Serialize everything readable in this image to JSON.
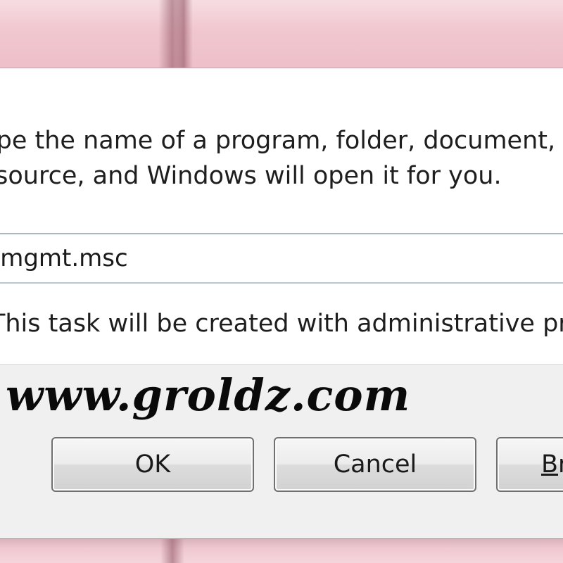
{
  "dialog": {
    "message_line_1": "Type the name of a program, folder, document, or Internet",
    "message_line_2": "resource, and Windows will open it for you.",
    "open_input_value": "compmgmt.msc",
    "admin_note": "This task will be created with administrative privileges."
  },
  "buttons": {
    "ok_label": "OK",
    "cancel_label": "Cancel",
    "browse_label": "Browse..."
  },
  "watermark": "www.groldz.com",
  "colors": {
    "frame": "#f1c7cf",
    "client": "#ffffff",
    "button_bar": "#f0f0f0",
    "input_border": "#b8c6d6"
  }
}
